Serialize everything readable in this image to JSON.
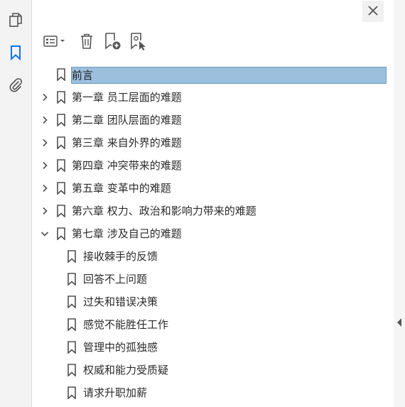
{
  "rail": {
    "icons": [
      "pages-icon",
      "bookmark-icon",
      "attachment-icon"
    ]
  },
  "toolbar": {
    "options_icon": "list-options-icon",
    "delete_icon": "trash-icon",
    "add_icon": "new-bookmark-icon",
    "select_icon": "bookmark-select-icon"
  },
  "bookmarks": [
    {
      "label": "前言",
      "level": 0,
      "expandable": false,
      "selected": true
    },
    {
      "label": "第一章  员工层面的难题",
      "level": 0,
      "expandable": true,
      "expanded": false
    },
    {
      "label": "第二章  团队层面的难题",
      "level": 0,
      "expandable": true,
      "expanded": false
    },
    {
      "label": "第三章  来自外界的难题",
      "level": 0,
      "expandable": true,
      "expanded": false
    },
    {
      "label": "第四章  冲突带来的难题",
      "level": 0,
      "expandable": true,
      "expanded": false
    },
    {
      "label": "第五章  变革中的难题",
      "level": 0,
      "expandable": true,
      "expanded": false
    },
    {
      "label": "第六章  权力、政治和影响力带来的难题",
      "level": 0,
      "expandable": true,
      "expanded": false
    },
    {
      "label": "第七章  涉及自己的难题",
      "level": 0,
      "expandable": true,
      "expanded": true
    },
    {
      "label": "接收棘手的反馈",
      "level": 1
    },
    {
      "label": "回答不上问题",
      "level": 1
    },
    {
      "label": "过失和错误决策",
      "level": 1
    },
    {
      "label": "感觉不能胜任工作",
      "level": 1
    },
    {
      "label": "管理中的孤独感",
      "level": 1
    },
    {
      "label": "权威和能力受质疑",
      "level": 1
    },
    {
      "label": "请求升职加薪",
      "level": 1
    }
  ],
  "colors": {
    "accent": "#1473e6",
    "selection": "#9bbfdc",
    "icon": "#505050"
  }
}
